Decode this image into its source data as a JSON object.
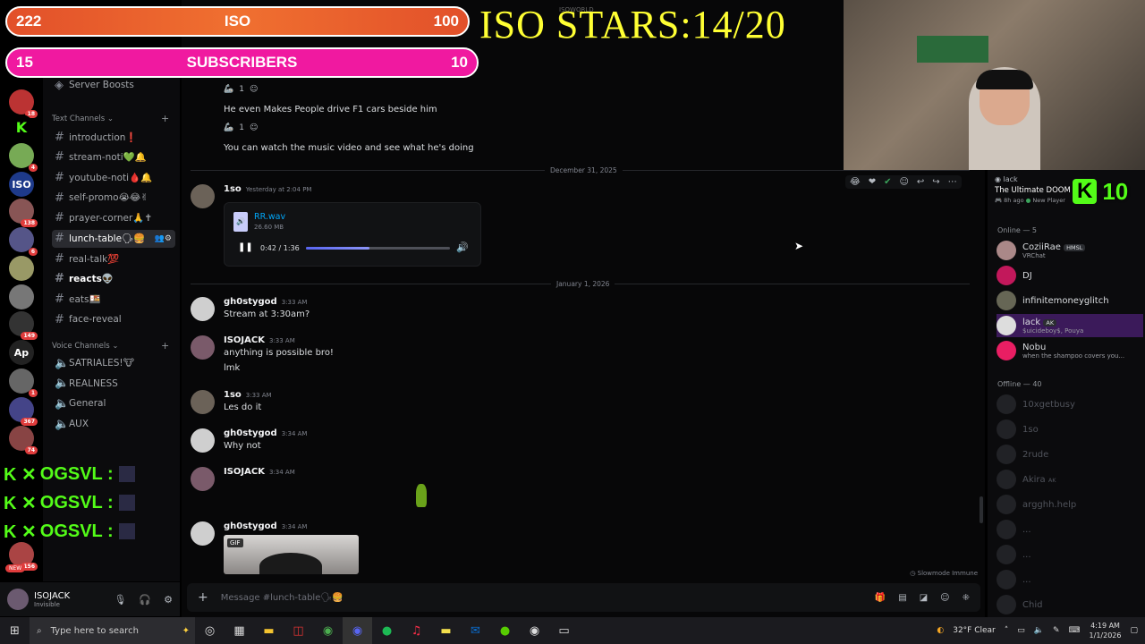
{
  "overlay": {
    "iso_bar": {
      "left": "222",
      "label": "ISO",
      "right": "100"
    },
    "sub_bar": {
      "left": "15",
      "label": "SUBSCRIBERS",
      "right": "10"
    },
    "stars_text": "ISO STARS:14/20",
    "server_name_faint": "ISOWORLD",
    "kick_rows": [
      {
        "label": "OGSVL :"
      },
      {
        "label": "OGSVL :"
      },
      {
        "label": "OGSVL :"
      }
    ],
    "kick_badge_value": "10",
    "new_label": "NEW"
  },
  "servers": [
    {
      "badge": "18",
      "color": "#b33"
    },
    {
      "text": "K",
      "color": "#53fc18"
    },
    {
      "badge": "4",
      "color": "#7a5"
    },
    {
      "text": "ISO",
      "color": "#1e3a8a"
    },
    {
      "badge": "138",
      "color": "#855"
    },
    {
      "badge": "6",
      "color": "#558"
    },
    {
      "color": "#996"
    },
    {
      "color": "#777"
    },
    {
      "badge": "149",
      "color": "#333"
    },
    {
      "text": "Ap",
      "color": "#222"
    },
    {
      "badge": "1",
      "color": "#666"
    },
    {
      "badge": "367",
      "color": "#448"
    },
    {
      "badge": "74",
      "color": "#844"
    },
    {
      "badge": "156",
      "color": "#a44"
    }
  ],
  "sidebar": {
    "server_boosts": "Server Boosts",
    "text_category": "Text Channels",
    "voice_category": "Voice Channels",
    "text_channels": [
      {
        "name": "introduction❗"
      },
      {
        "name": "stream-noti💚🔔"
      },
      {
        "name": "youtube-noti🩸🔔"
      },
      {
        "name": "self-promo😭😂✌"
      },
      {
        "name": "prayer-corner🙏✝"
      },
      {
        "name": "lunch-table🗣🍔"
      },
      {
        "name": "real-talk💯"
      },
      {
        "name": "reacts👽"
      },
      {
        "name": "eats🍱"
      },
      {
        "name": "face-reveal"
      }
    ],
    "voice_channels": [
      {
        "name": "SATRIALES!🐮"
      },
      {
        "name": "REALNESS"
      },
      {
        "name": "General"
      },
      {
        "name": "AUX"
      }
    ]
  },
  "user_panel": {
    "name": "ISOJACK",
    "status": "Invisible"
  },
  "chat": {
    "reaction_count_1": "1",
    "reaction_count_2": "1",
    "msg_f1": "He even Makes People drive F1 cars beside him",
    "msg_video": "You can watch the music video and see what he's doing",
    "date_1": "December 31, 2025",
    "post_1": {
      "author": "1so",
      "time": "Yesterday at 2:04 PM"
    },
    "attachment": {
      "filename": "RR.wav",
      "size": "26.60 MB",
      "time": "0:42 / 1:36",
      "progress": 0.44
    },
    "date_2": "January 1, 2026",
    "messages": [
      {
        "author": "gh0stygod",
        "time": "3:33 AM",
        "lines": [
          "Stream at 3:30am?"
        ]
      },
      {
        "author": "ISOJACK",
        "time": "3:33 AM",
        "lines": [
          "anything is possible bro!",
          "lmk"
        ]
      },
      {
        "author": "1so",
        "time": "3:33 AM",
        "lines": [
          "Les do it"
        ]
      },
      {
        "author": "gh0stygod",
        "time": "3:34 AM",
        "lines": [
          "Why not"
        ]
      },
      {
        "author": "ISOJACK",
        "time": "3:34 AM",
        "lines": []
      },
      {
        "author": "gh0stygod",
        "time": "3:34 AM",
        "lines": []
      }
    ],
    "gif_label": "GIF",
    "slowmode": "Slowmode Immune",
    "composer_placeholder": "Message #lunch-table🗣🍔"
  },
  "activity_card": {
    "name": "lack",
    "game": "The Ultimate DOOM",
    "ago": "8h ago",
    "new_players": "New Player"
  },
  "members": {
    "online_header": "Online — 5",
    "online": [
      {
        "name": "CoziiRae",
        "tag": "HMSL",
        "sub": "VRChat",
        "color": "#a88"
      },
      {
        "name": "DJ",
        "sub": "",
        "color": "#c2185b"
      },
      {
        "name": "infinitemoneyglitch",
        "sub": "",
        "color": "#665"
      },
      {
        "name": "lack",
        "tag": "AK",
        "sub": "$uicideboy$, Pouya",
        "color": "#ddd"
      },
      {
        "name": "Nobu",
        "sub": "when the shampoo covers you...",
        "color": "#e91e63"
      }
    ],
    "offline_header": "Offline — 40",
    "offline": [
      {
        "name": "10xgetbusy"
      },
      {
        "name": "1so"
      },
      {
        "name": "2rude"
      },
      {
        "name": "Akira",
        "tag": "AK"
      },
      {
        "name": "argghh.help"
      },
      {
        "name": "..."
      },
      {
        "name": "..."
      },
      {
        "name": "..."
      },
      {
        "name": "Chid"
      }
    ]
  },
  "taskbar": {
    "search_placeholder": "Type here to search",
    "weather": "32°F  Clear",
    "time": "4:19 AM",
    "date": "1/1/2026"
  }
}
